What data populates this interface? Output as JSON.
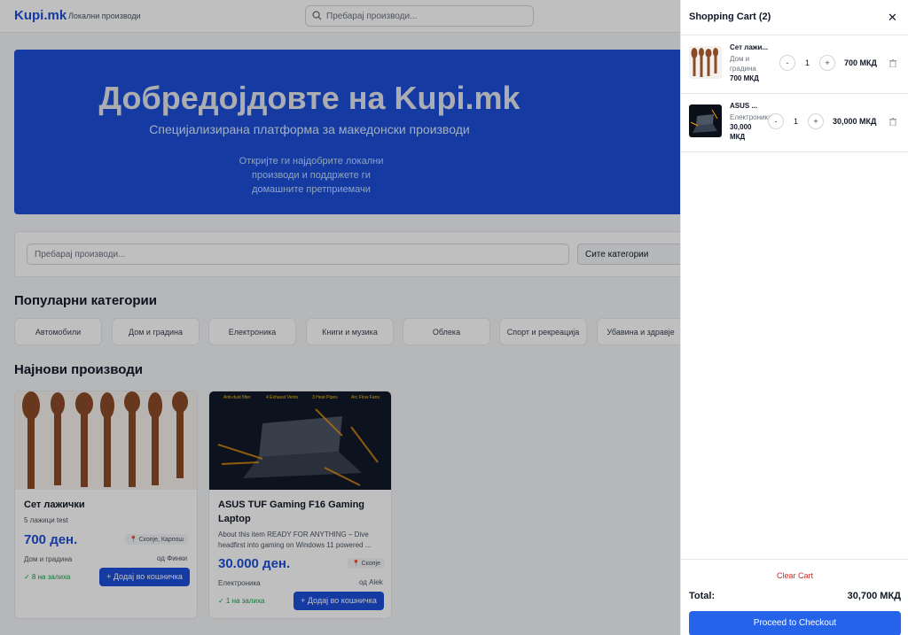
{
  "header": {
    "logo": "Kupi.mk",
    "tagline": "Локални производи",
    "search_placeholder": "Пребарај производи..."
  },
  "hero": {
    "title": "Добредојдовте на Kupi.mk",
    "subtitle": "Специјализирана платформа за македонски производи",
    "description": "Откријте ги најдобрите локални производи и поддржете ги домашните претприемачи"
  },
  "filter": {
    "search_placeholder": "Пребарај производи...",
    "category_value": "Сите категории"
  },
  "categories_title": "Популарни категории",
  "categories": [
    "Автомобили",
    "Дом и градина",
    "Електроника",
    "Книги и музика",
    "Облека",
    "Спорт и рекреација",
    "Убавина и здравје"
  ],
  "products_title": "Најнови производи",
  "products": [
    {
      "name": "Сет лажички",
      "desc": "5 лажици test",
      "price": "700 ден.",
      "location": "Скопје, Карпош",
      "category": "Дом и градина",
      "seller": "од Финки",
      "stock": "✓ 8 на залиха",
      "button": "+ Додај во кошничка"
    },
    {
      "name": "ASUS TUF Gaming F16 Gaming Laptop",
      "desc": "About this item  READY FOR ANYTHING – Dive headfirst into gaming on Windows 11 powered ...",
      "price": "30.000 ден.",
      "location": "Скопје",
      "category": "Електроника",
      "seller": "од Alek",
      "stock": "✓ 1 на залиха",
      "button": "+ Додај во кошничка",
      "image_labels": [
        "Anti-dust filter",
        "4 Exhaust Vents",
        "3 Heat Pipes",
        "Arc Flow Fans"
      ]
    }
  ],
  "cart": {
    "title": "Shopping Cart (2)",
    "close": "✕",
    "items": [
      {
        "name": "Сет лажи...",
        "category_l1": "Дом и",
        "category_l2": "градина",
        "price": "700 МКД",
        "qty": "1",
        "minus": "-",
        "plus": "+",
        "total": "700 МКД"
      },
      {
        "name": "ASUS ...",
        "category_l1": "Електроника",
        "price_l1": "30,000",
        "price_l2": "МКД",
        "qty": "1",
        "minus": "-",
        "plus": "+",
        "total": "30,000 МКД"
      }
    ],
    "clear": "Clear Cart",
    "total_label": "Total:",
    "total_value": "30,700 МКД",
    "checkout": "Proceed to Checkout"
  },
  "colors": {
    "accent": "#1d4ed8",
    "checkout": "#2563eb",
    "danger": "#dc2626",
    "stock": "#16a34a"
  }
}
